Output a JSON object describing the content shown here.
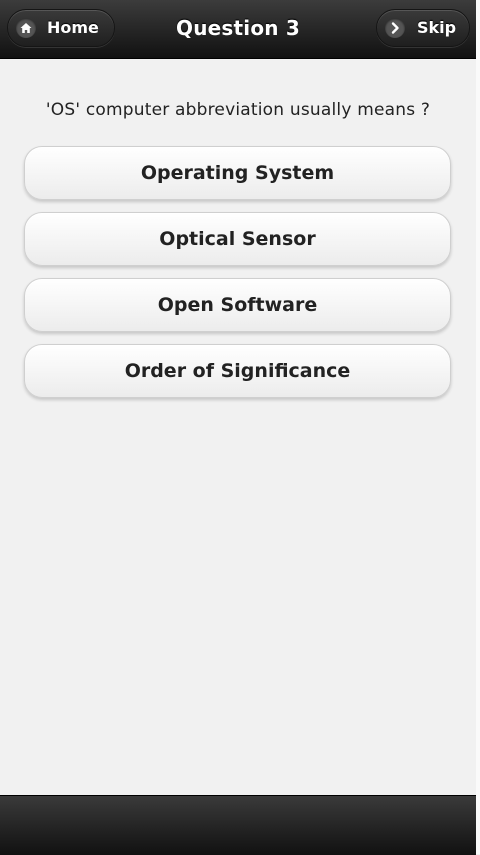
{
  "header": {
    "title": "Question 3",
    "home_label": "Home",
    "skip_label": "Skip"
  },
  "question": {
    "text": "'OS' computer abbreviation usually means ?"
  },
  "answers": [
    {
      "label": "Operating System"
    },
    {
      "label": "Optical Sensor"
    },
    {
      "label": "Open Software"
    },
    {
      "label": "Order of Significance"
    }
  ],
  "icons": {
    "home": "home-icon",
    "skip": "chevron-right-icon"
  },
  "colors": {
    "header_bg": "#1f1f1f",
    "page_bg": "#f1f1f1",
    "button_bg": "#f7f7f7"
  }
}
